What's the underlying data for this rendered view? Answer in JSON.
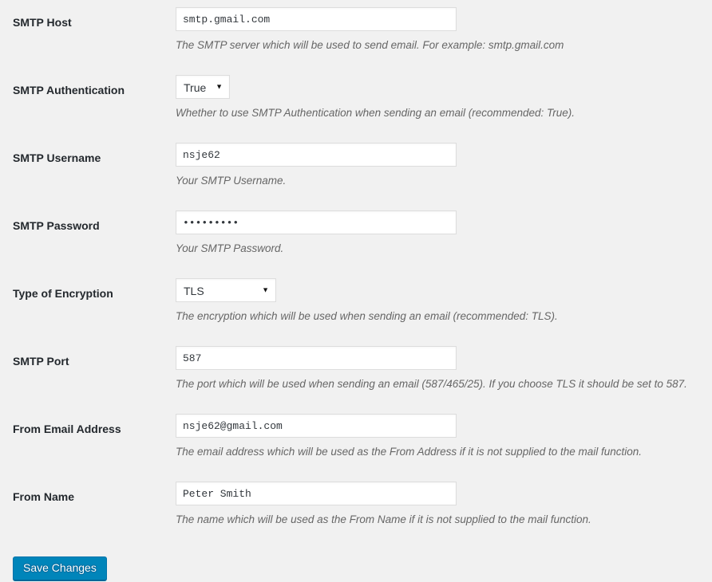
{
  "colors": {
    "page_background": "#f1f1f1",
    "label_text": "#23282d",
    "description_text": "#666666",
    "input_border": "#dddddd",
    "input_background": "#ffffff",
    "primary_button_background": "#0085ba",
    "primary_button_border": "#0073aa"
  },
  "icons": {
    "select_arrow": "▼"
  },
  "form": {
    "rows": [
      {
        "label": "SMTP Host",
        "control_type": "text",
        "value": "smtp.gmail.com",
        "description": "The SMTP server which will be used to send email. For example: smtp.gmail.com"
      },
      {
        "label": "SMTP Authentication",
        "control_type": "select",
        "value": "True",
        "description": "Whether to use SMTP Authentication when sending an email (recommended: True)."
      },
      {
        "label": "SMTP Username",
        "control_type": "text",
        "value": "nsje62",
        "description": "Your SMTP Username."
      },
      {
        "label": "SMTP Password",
        "control_type": "password",
        "value": "•••••••••",
        "description": "Your SMTP Password."
      },
      {
        "label": "Type of Encryption",
        "control_type": "select",
        "value": "TLS",
        "description": "The encryption which will be used when sending an email (recommended: TLS)."
      },
      {
        "label": "SMTP Port",
        "control_type": "text",
        "value": "587",
        "description": "The port which will be used when sending an email (587/465/25). If you choose TLS it should be set to 587."
      },
      {
        "label": "From Email Address",
        "control_type": "text",
        "value": "nsje62@gmail.com",
        "description": "The email address which will be used as the From Address if it is not supplied to the mail function."
      },
      {
        "label": "From Name",
        "control_type": "text",
        "value": "Peter Smith",
        "description": "The name which will be used as the From Name if it is not supplied to the mail function."
      }
    ]
  },
  "submit": {
    "save_label": "Save Changes"
  }
}
